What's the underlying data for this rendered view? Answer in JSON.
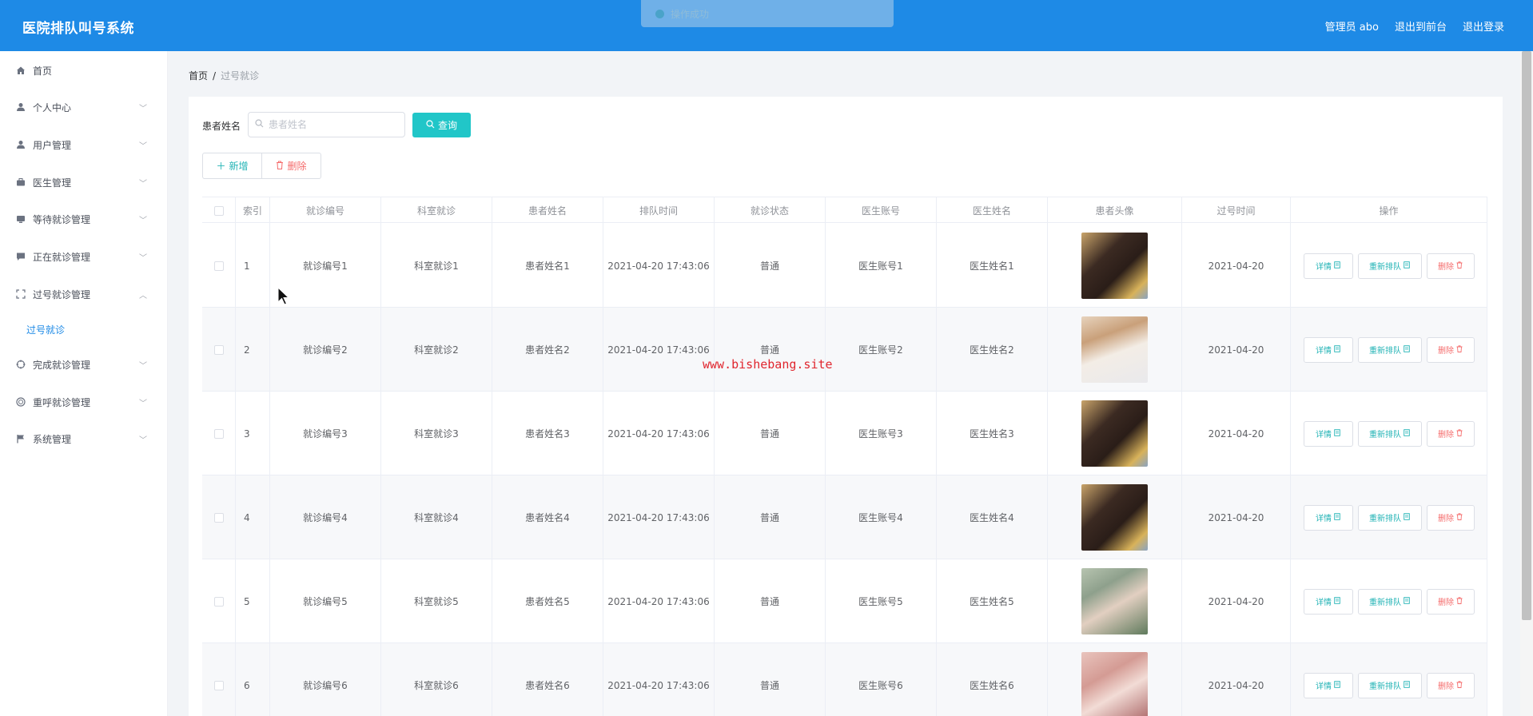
{
  "app": {
    "title": "医院排队叫号系统"
  },
  "header": {
    "admin_label": "管理员 abo",
    "back_front_label": "退出到前台",
    "logout_label": "退出登录"
  },
  "toast": {
    "text": "操作成功"
  },
  "sidebar": {
    "items": [
      {
        "label": "首页",
        "icon": "home-icon"
      },
      {
        "label": "个人中心",
        "icon": "user-icon"
      },
      {
        "label": "用户管理",
        "icon": "user-icon"
      },
      {
        "label": "医生管理",
        "icon": "briefcase-icon"
      },
      {
        "label": "等待就诊管理",
        "icon": "monitor-icon"
      },
      {
        "label": "正在就诊管理",
        "icon": "chat-icon"
      },
      {
        "label": "过号就诊管理",
        "icon": "fullscreen-icon"
      },
      {
        "label": "完成就诊管理",
        "icon": "aim-icon"
      },
      {
        "label": "重呼就诊管理",
        "icon": "globe-icon"
      },
      {
        "label": "系统管理",
        "icon": "flag-icon"
      }
    ],
    "active_sub_item": "过号就诊"
  },
  "breadcrumb": {
    "home": "首页",
    "current": "过号就诊"
  },
  "search": {
    "label": "患者姓名",
    "placeholder": "患者姓名",
    "button_label": "查询"
  },
  "actions": {
    "add_label": "新增",
    "delete_label": "删除"
  },
  "table": {
    "columns": [
      "索引",
      "就诊编号",
      "科室就诊",
      "患者姓名",
      "排队时间",
      "就诊状态",
      "医生账号",
      "医生姓名",
      "患者头像",
      "过号时间",
      "操作"
    ],
    "op_labels": {
      "detail": "详情",
      "requeue": "重新排队",
      "remove": "删除"
    },
    "rows": [
      {
        "index": "1",
        "visit_no": "就诊编号1",
        "dept": "科室就诊1",
        "patient": "患者姓名1",
        "queue_time": "2021-04-20 17:43:06",
        "status": "普通",
        "doctor_account": "医生账号1",
        "doctor_name": "医生姓名1",
        "avatar": "photo-1",
        "missed_time": "2021-04-20"
      },
      {
        "index": "2",
        "visit_no": "就诊编号2",
        "dept": "科室就诊2",
        "patient": "患者姓名2",
        "queue_time": "2021-04-20 17:43:06",
        "status": "普通",
        "doctor_account": "医生账号2",
        "doctor_name": "医生姓名2",
        "avatar": "photo-2",
        "missed_time": "2021-04-20"
      },
      {
        "index": "3",
        "visit_no": "就诊编号3",
        "dept": "科室就诊3",
        "patient": "患者姓名3",
        "queue_time": "2021-04-20 17:43:06",
        "status": "普通",
        "doctor_account": "医生账号3",
        "doctor_name": "医生姓名3",
        "avatar": "photo-1",
        "missed_time": "2021-04-20"
      },
      {
        "index": "4",
        "visit_no": "就诊编号4",
        "dept": "科室就诊4",
        "patient": "患者姓名4",
        "queue_time": "2021-04-20 17:43:06",
        "status": "普通",
        "doctor_account": "医生账号4",
        "doctor_name": "医生姓名4",
        "avatar": "photo-1",
        "missed_time": "2021-04-20"
      },
      {
        "index": "5",
        "visit_no": "就诊编号5",
        "dept": "科室就诊5",
        "patient": "患者姓名5",
        "queue_time": "2021-04-20 17:43:06",
        "status": "普通",
        "doctor_account": "医生账号5",
        "doctor_name": "医生姓名5",
        "avatar": "photo-3",
        "missed_time": "2021-04-20"
      },
      {
        "index": "6",
        "visit_no": "就诊编号6",
        "dept": "科室就诊6",
        "patient": "患者姓名6",
        "queue_time": "2021-04-20 17:43:06",
        "status": "普通",
        "doctor_account": "医生账号6",
        "doctor_name": "医生姓名6",
        "avatar": "photo-4",
        "missed_time": "2021-04-20"
      }
    ]
  },
  "watermark": "www.bishebang.site",
  "colors": {
    "header": "#1e8ae6",
    "accent": "#21c6c8",
    "danger": "#f56c6c",
    "watermark": "#e0262e"
  }
}
